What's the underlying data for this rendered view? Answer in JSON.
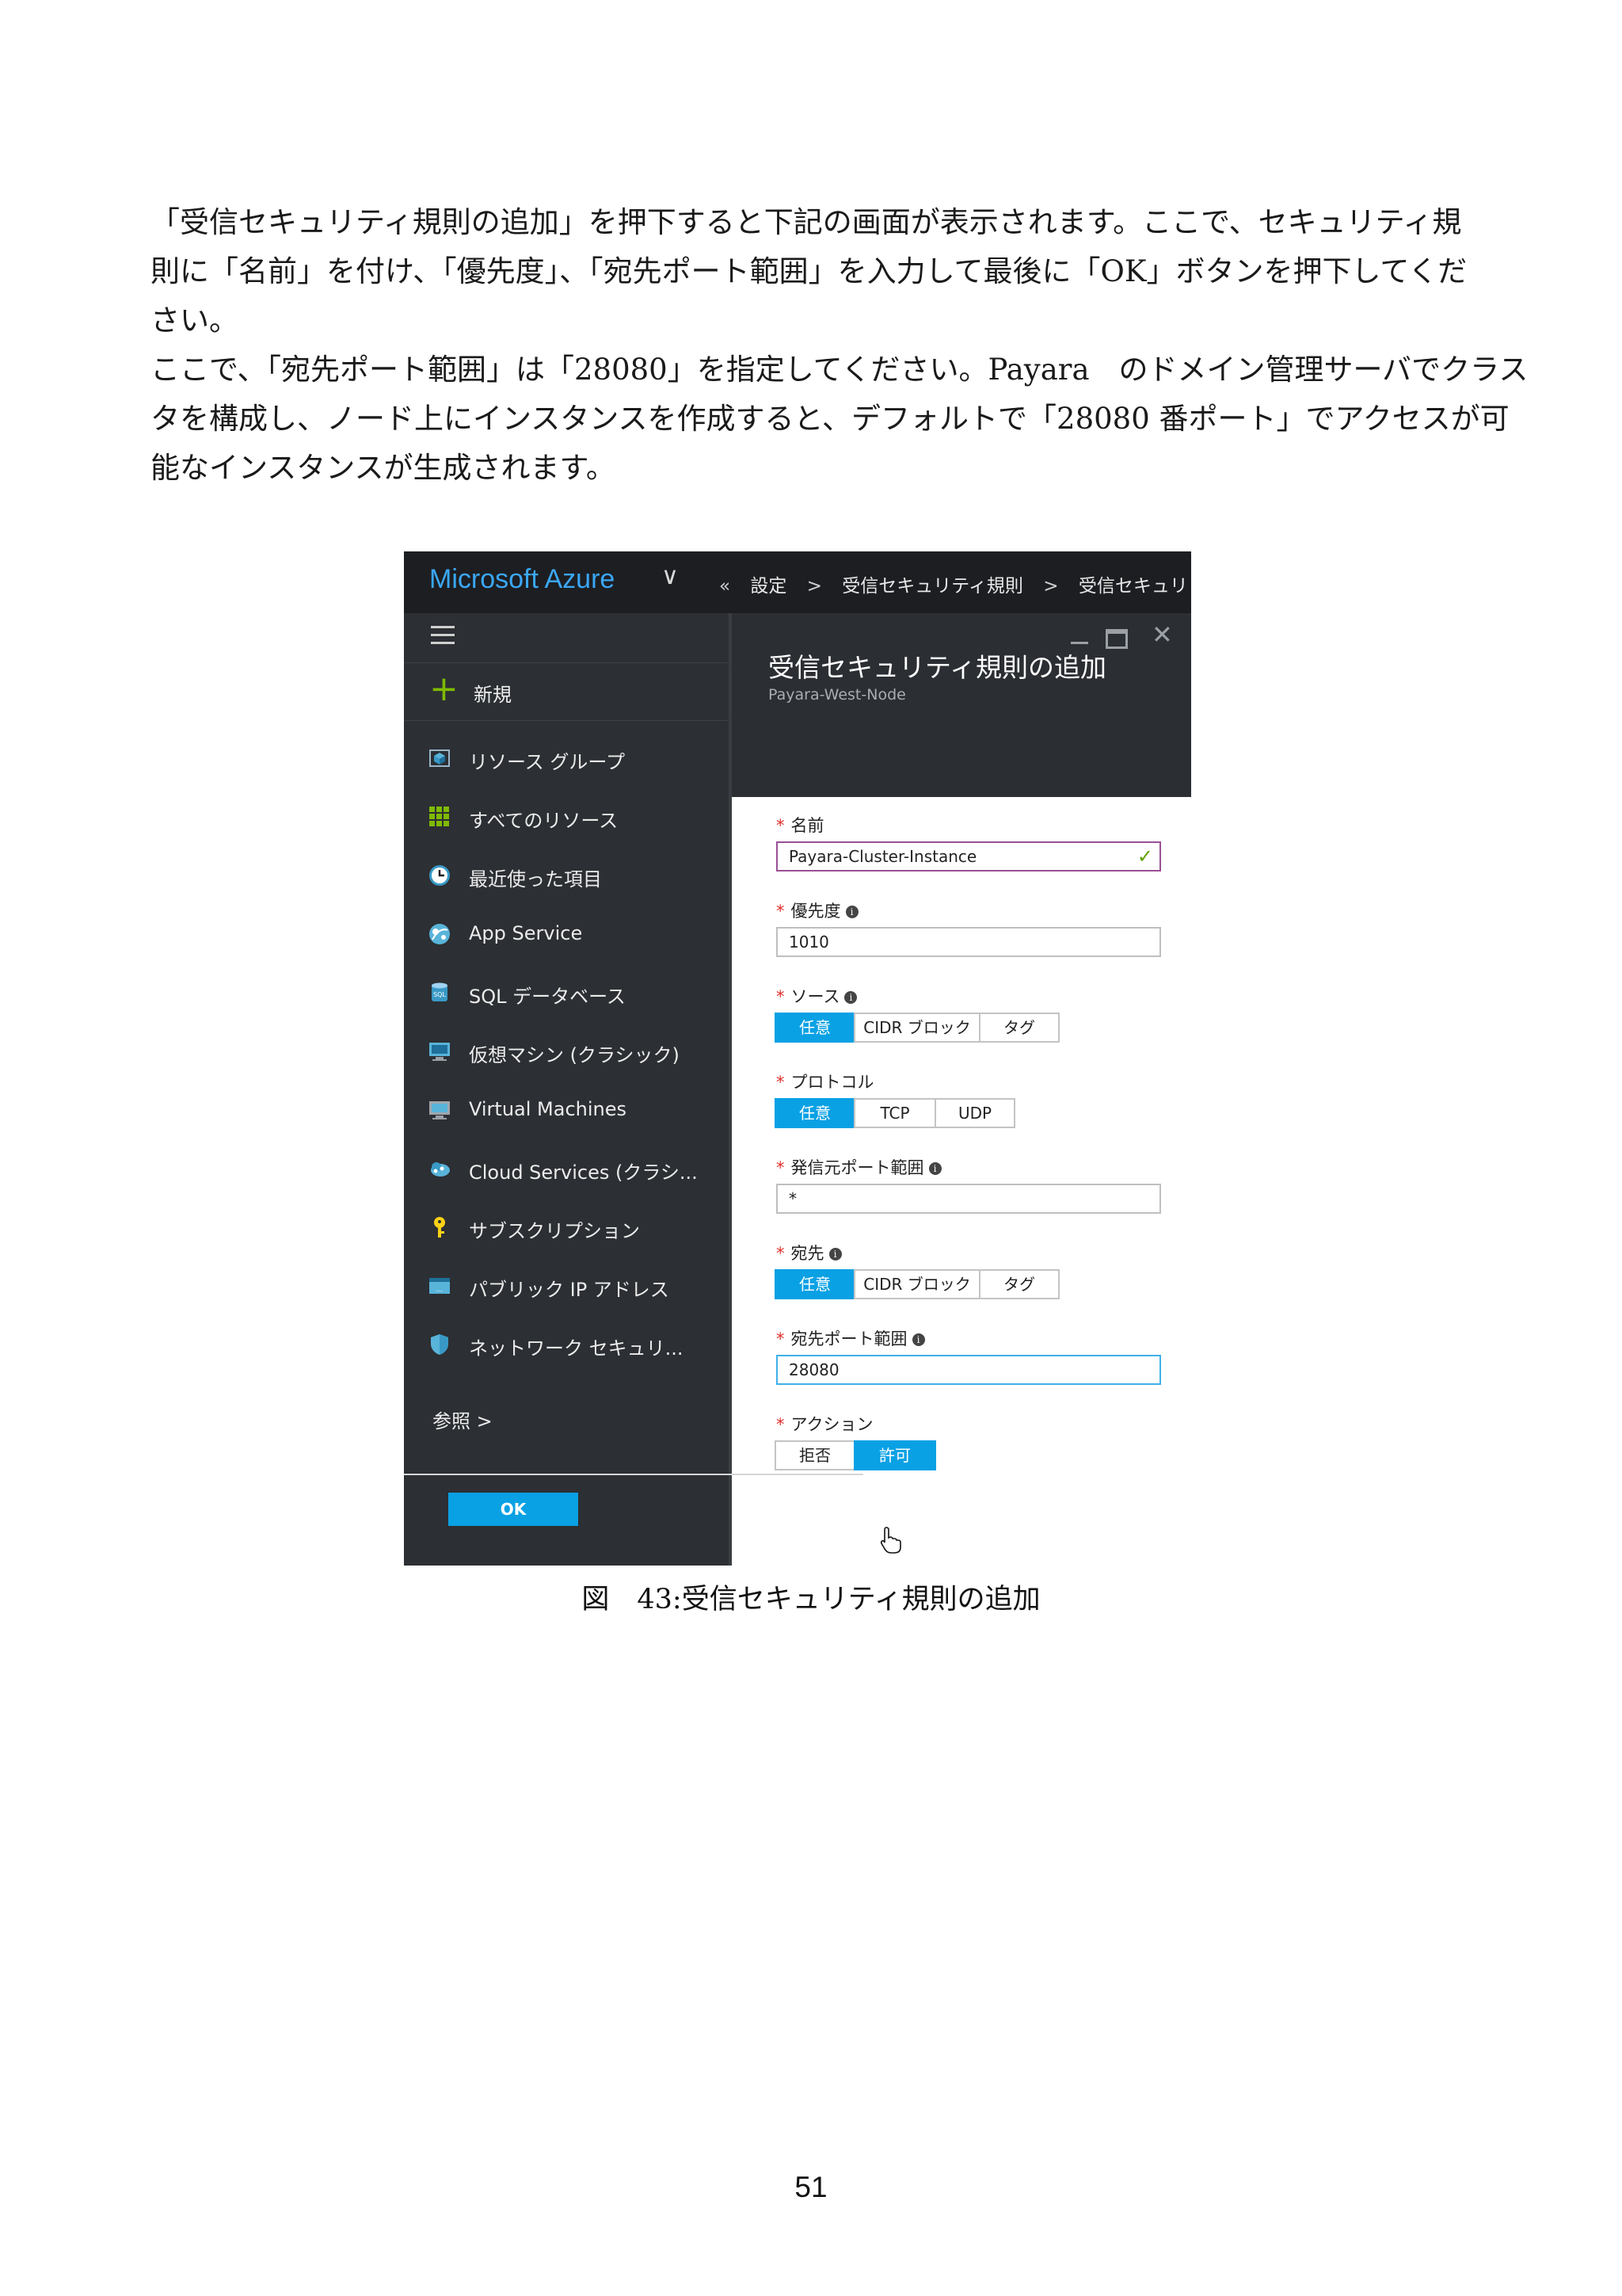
{
  "body": {
    "p1": [
      "「受信セキュリティ規則の追加」を押下すると下記の画面が表示されます。ここで、セキュリティ規",
      "則に「名前」を付け、「優先度」、「宛先ポート範囲」を入力して最後に「OK」ボタンを押下してくだ",
      "さい。"
    ],
    "p2": [
      "ここで、「宛先ポート範囲」は「28080」を指定してください。Payara　のドメイン管理サーバでクラス",
      "タを構成し、ノード上にインスタンスを作成すると、デフォルトで「28080 番ポート」でアクセスが可",
      "能なインスタンスが生成されます。"
    ]
  },
  "azure": {
    "brand": "Microsoft Azure",
    "brand_chevron": "∨",
    "breadcrumb": [
      "«",
      "設定",
      ">",
      "受信セキュリティ規則",
      ">",
      "受信セキュリ"
    ],
    "sidebar": {
      "new_label": "新規",
      "items": [
        {
          "label": "リソース グループ",
          "icon": "resource-group-icon"
        },
        {
          "label": "すべてのリソース",
          "icon": "all-resources-icon"
        },
        {
          "label": "最近使った項目",
          "icon": "clock-icon"
        },
        {
          "label": "App Service",
          "icon": "app-service-icon"
        },
        {
          "label": "SQL データベース",
          "icon": "sql-database-icon"
        },
        {
          "label": "仮想マシン (クラシック)",
          "icon": "vm-classic-icon"
        },
        {
          "label": "Virtual Machines",
          "icon": "virtual-machines-icon"
        },
        {
          "label": "Cloud Services (クラシ...",
          "icon": "cloud-services-icon"
        },
        {
          "label": "サブスクリプション",
          "icon": "key-icon"
        },
        {
          "label": "パブリック IP アドレス",
          "icon": "public-ip-icon"
        },
        {
          "label": "ネットワーク セキュリ...",
          "icon": "shield-icon"
        }
      ],
      "browse_label": "参照 >"
    },
    "blade": {
      "title": "受信セキュリティ規則の追加",
      "subtitle": "Payara-West-Node"
    },
    "form": {
      "name_label": "名前",
      "name_value": "Payara-Cluster-Instance",
      "priority_label": "優先度",
      "priority_value": "1010",
      "source_label": "ソース",
      "source_options": [
        "任意",
        "CIDR ブロック",
        "タグ"
      ],
      "protocol_label": "プロトコル",
      "protocol_options": [
        "任意",
        "TCP",
        "UDP"
      ],
      "src_port_label": "発信元ポート範囲",
      "src_port_value": "*",
      "dest_label": "宛先",
      "dest_options": [
        "任意",
        "CIDR ブロック",
        "タグ"
      ],
      "dest_port_label": "宛先ポート範囲",
      "dest_port_value": "28080",
      "action_label": "アクション",
      "action_options": [
        "拒否",
        "許可"
      ],
      "ok_label": "OK"
    },
    "colors": {
      "accent": "#09a1e4",
      "required": "#e0312d",
      "sidebar": "#2c2f33",
      "brand": "#3ba7f5"
    }
  },
  "caption": "図　43:受信セキュリティ規則の追加",
  "page_number": "51"
}
